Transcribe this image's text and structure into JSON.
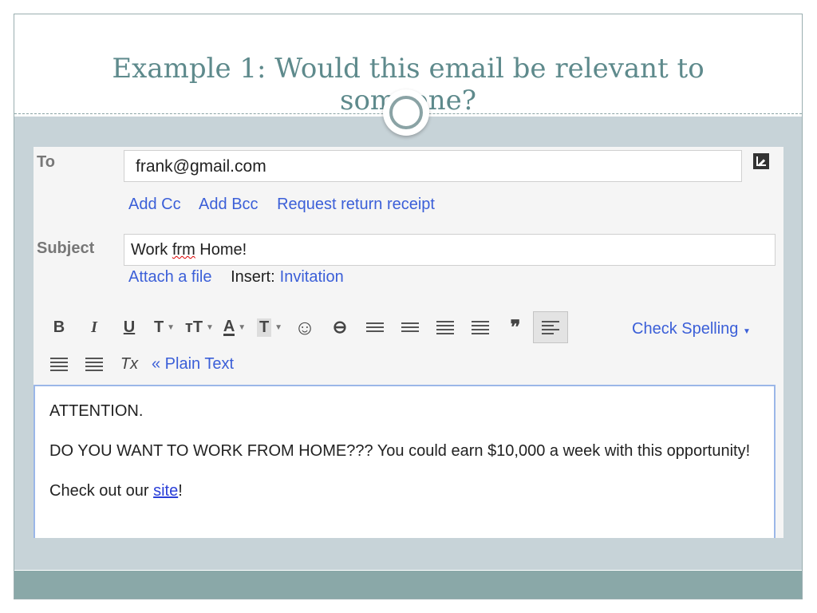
{
  "slide": {
    "title_line1": "Example 1: Would this email be relevant to",
    "title_line2": "someone?"
  },
  "compose": {
    "to_label": "To",
    "to_value": "frank@gmail.com",
    "recipient_links": [
      "Add Cc",
      "Add Bcc",
      "Request return receipt"
    ],
    "subject_label": "Subject",
    "subject_value_pre": "Work ",
    "subject_value_misspelled": "frm",
    "subject_value_post": " Home!",
    "attach_label": "Attach a file",
    "insert_label": "Insert:",
    "invitation_label": "Invitation",
    "toolbar": {
      "bold": "B",
      "italic": "I",
      "underline": "U",
      "font": "T",
      "size": "тT",
      "text_color": "A",
      "highlight": "T",
      "emoji": "☺",
      "link": "⊖",
      "quote": "❞",
      "check_spelling": "Check Spelling",
      "remove_format": "Tx",
      "plain_text": "« Plain Text"
    },
    "body": {
      "line1": "ATTENTION.",
      "line2": "DO YOU WANT TO WORK FROM HOME???  You could earn $10,000 a week with this opportunity!",
      "line3_pre": "Check out our ",
      "line3_link": "site",
      "line3_post": "!"
    }
  },
  "colors": {
    "title": "#5e8a8c",
    "link": "#3b5fd8",
    "band": "#c7d3d8",
    "footer": "#8aa8a8"
  }
}
